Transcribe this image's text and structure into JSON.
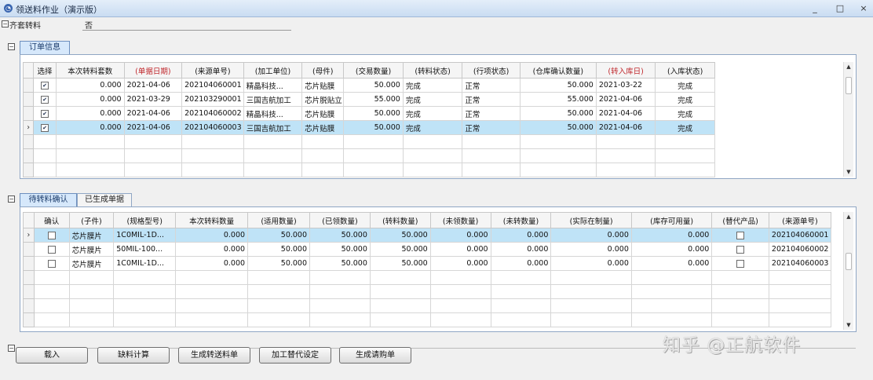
{
  "window": {
    "title": "领送料作业（演示版）",
    "minimize": "_",
    "maximize": "□",
    "close": "×"
  },
  "header": {
    "field_label": "齐套转料",
    "field_value": "否"
  },
  "orders": {
    "tab_label": "订单信息",
    "columns": [
      "选择",
      "本次转料套数",
      "(单据日期)",
      "(来源单号)",
      "(加工单位)",
      "(母件)",
      "(交易数量)",
      "(转料状态)",
      "(行项状态)",
      "(仓库确认数量)",
      "(转入库日)",
      "(入库状态)"
    ],
    "rows": [
      [
        "✔",
        "0.000",
        "2021-04-06",
        "202104060001",
        "精晶科技...",
        "芯片贴膜",
        "50.000",
        "完成",
        "正常",
        "50.000",
        "2021-03-22",
        "完成"
      ],
      [
        "✔",
        "0.000",
        "2021-03-29",
        "202103290001",
        "三国吉航加工",
        "芯片脱贴立",
        "55.000",
        "完成",
        "正常",
        "55.000",
        "2021-04-06",
        "完成"
      ],
      [
        "✔",
        "0.000",
        "2021-04-06",
        "202104060002",
        "精晶科技...",
        "芯片贴膜",
        "50.000",
        "完成",
        "正常",
        "50.000",
        "2021-04-06",
        "完成"
      ],
      [
        "✔",
        "0.000",
        "2021-04-06",
        "202104060003",
        "三国吉航加工",
        "芯片贴膜",
        "50.000",
        "完成",
        "正常",
        "50.000",
        "2021-04-06",
        "完成"
      ]
    ],
    "current_row_marker": "›"
  },
  "transfer": {
    "tab_active": "待转料确认",
    "tab_other": "已生成单据",
    "columns": [
      "确认",
      "(子件)",
      "(规格型号)",
      "本次转料数量",
      "(适用数量)",
      "(已领数量)",
      "(转料数量)",
      "(未领数量)",
      "(未转数量)",
      "(实际在制量)",
      "(库存可用量)",
      "(替代产品)",
      "(来源单号)"
    ],
    "rows": [
      [
        "",
        "芯片膜片",
        "1C0MIL-1D...",
        "0.000",
        "50.000",
        "50.000",
        "50.000",
        "0.000",
        "0.000",
        "0.000",
        "0.000",
        "",
        "202104060001"
      ],
      [
        "",
        "芯片膜片",
        "50MIL-100...",
        "0.000",
        "50.000",
        "50.000",
        "50.000",
        "0.000",
        "0.000",
        "0.000",
        "0.000",
        "",
        "202104060002"
      ],
      [
        "",
        "芯片膜片",
        "1C0MIL-1D...",
        "0.000",
        "50.000",
        "50.000",
        "50.000",
        "0.000",
        "0.000",
        "0.000",
        "0.000",
        "",
        "202104060003"
      ]
    ],
    "current_row_marker": "›"
  },
  "buttons": {
    "load": "载入",
    "shortage_calc": "缺料计算",
    "gen_transfer": "生成转送料单",
    "subst_setting": "加工替代设定",
    "gen_purchase": "生成请购单"
  },
  "watermark": "知乎 @正航软件",
  "colors": {
    "selected_row": "#bfe3f7",
    "header_red": "#c0282d",
    "active_tab": "#d6e8fb"
  }
}
